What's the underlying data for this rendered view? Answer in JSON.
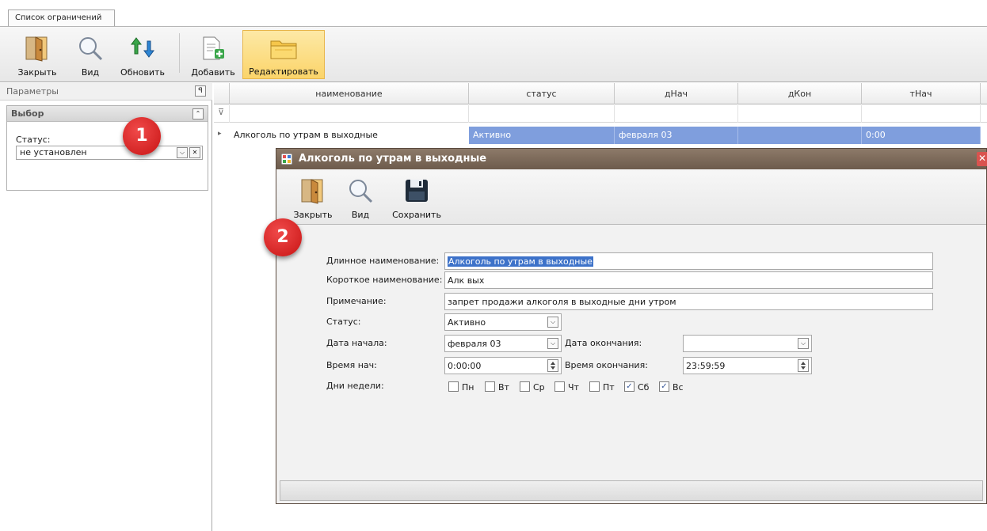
{
  "tab": {
    "label": "Список ограничений"
  },
  "toolbar": {
    "close_label": "Закрыть",
    "view_label": "Вид",
    "refresh_label": "Обновить",
    "add_label": "Добавить",
    "edit_label": "Редактировать"
  },
  "left_panel": {
    "header": "Параметры",
    "pin_glyph": "ꟼ",
    "group_title": "Выбор",
    "collapse_glyph": "⌃",
    "status_label": "Статус:",
    "status_value": "не установлен",
    "dropdown_glyph": "⌵",
    "clear_glyph": "✕"
  },
  "grid": {
    "filter_glyph": "⊽",
    "columns": [
      "наименование",
      "статус",
      "дНач",
      "дКон",
      "тНач"
    ],
    "rows": [
      {
        "marker": "▸",
        "name": "Алкоголь по утрам в выходные",
        "status": "Активно",
        "dnach": "февраля 03",
        "dkon": "",
        "tnach": "0:00"
      }
    ]
  },
  "dialog": {
    "title": "Алкоголь по утрам в выходные",
    "close_glyph": "✕",
    "toolbar": {
      "close_label": "Закрыть",
      "view_label": "Вид",
      "save_label": "Сохранить"
    },
    "fields": {
      "long_name_label": "Длинное наименование:",
      "long_name_value": "Алкоголь по утрам в выходные",
      "short_name_label": "Короткое наименование:",
      "short_name_value": "Алк вых",
      "note_label": "Примечание:",
      "note_value": "запрет продажи алкоголя в выходные дни утром",
      "status_label": "Статус:",
      "status_value": "Активно",
      "start_date_label": "Дата начала:",
      "start_date_value": "февраля 03",
      "end_date_label": "Дата окончания:",
      "end_date_value": "",
      "start_time_label": "Время нач:",
      "start_time_value": "0:00:00",
      "end_time_label": "Время окончания:",
      "end_time_value": "23:59:59",
      "weekdays_label": "Дни недели:"
    },
    "weekdays": [
      {
        "label": "Пн",
        "checked": false
      },
      {
        "label": "Вт",
        "checked": false
      },
      {
        "label": "Ср",
        "checked": false
      },
      {
        "label": "Чт",
        "checked": false
      },
      {
        "label": "Пт",
        "checked": false
      },
      {
        "label": "Сб",
        "checked": true
      },
      {
        "label": "Вс",
        "checked": true
      }
    ]
  },
  "badges": {
    "one": "1",
    "two": "2"
  },
  "colors": {
    "selection": "#7f9edd",
    "dialog_title_bar": "#7a6756",
    "edit_button_active": "#fbd46a",
    "badge": "#d91e1e"
  }
}
